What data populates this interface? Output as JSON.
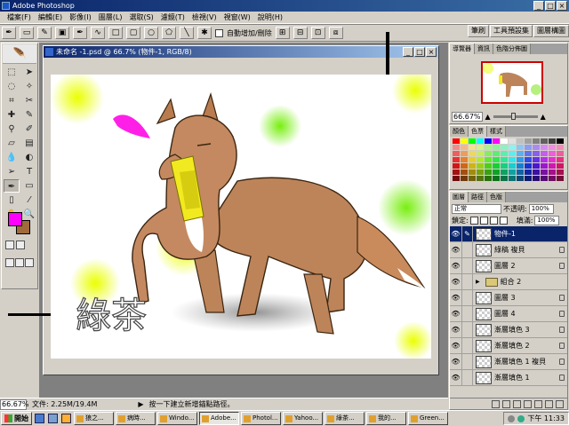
{
  "app": {
    "title": "Adobe Photoshop"
  },
  "menu": [
    "檔案(F)",
    "編輯(E)",
    "影像(I)",
    "圖層(L)",
    "選取(S)",
    "濾鏡(T)",
    "檢視(V)",
    "視窗(W)",
    "說明(H)"
  ],
  "options_bar": {
    "auto_add_label": "自動增加/刪除"
  },
  "palette_well": [
    "筆刷",
    "工具預設集",
    "圖層構圖"
  ],
  "document": {
    "title": "未命名 -1.psd @ 66.7% (物件-1, RGB/8)",
    "artwork_text": "綠茶"
  },
  "status": {
    "zoom": "66.67%",
    "doc_size": "文件: 2.25M/19.4M",
    "hint": "按一下建立新增錨點路徑。"
  },
  "navigator": {
    "tabs": [
      "導覽器",
      "資訊",
      "色階分佈圖"
    ],
    "zoom": "66.67%"
  },
  "color_panel": {
    "tabs": [
      "顏色",
      "色票",
      "樣式"
    ]
  },
  "layers_panel": {
    "tabs": [
      "圖層",
      "路徑",
      "色版"
    ],
    "blend_mode": "正常",
    "opacity_label": "不透明:",
    "opacity": "100%",
    "lock_label": "鎖定:",
    "fill_label": "填滿:",
    "fill": "100%",
    "layers": [
      {
        "name": "物件-1",
        "selected": true,
        "type": "layer",
        "locked": false
      },
      {
        "name": "綠稿 複貝",
        "selected": false,
        "type": "layer",
        "locked": true
      },
      {
        "name": "圖層 2",
        "selected": false,
        "type": "layer",
        "locked": true
      },
      {
        "name": "組合 2",
        "selected": false,
        "type": "group",
        "locked": false
      },
      {
        "name": "圖層 3",
        "selected": false,
        "type": "layer",
        "locked": true
      },
      {
        "name": "圖層 4",
        "selected": false,
        "type": "layer",
        "locked": true
      },
      {
        "name": "漸層填色 3",
        "selected": false,
        "type": "layer",
        "locked": true
      },
      {
        "name": "漸層填色 2",
        "selected": false,
        "type": "layer",
        "locked": true
      },
      {
        "name": "漸層填色 1 複貝",
        "selected": false,
        "type": "layer",
        "locked": true
      },
      {
        "name": "漸層填色 1",
        "selected": false,
        "type": "layer",
        "locked": true
      }
    ]
  },
  "taskbar": {
    "start": "開始",
    "tasks": [
      "狼之...",
      "病時...",
      "Windo...",
      "Adobe...",
      "Photol...",
      "Yahoo...",
      "綠茶...",
      "我的...",
      "Green..."
    ],
    "active_index": 3,
    "clock": "下午 11:33"
  }
}
